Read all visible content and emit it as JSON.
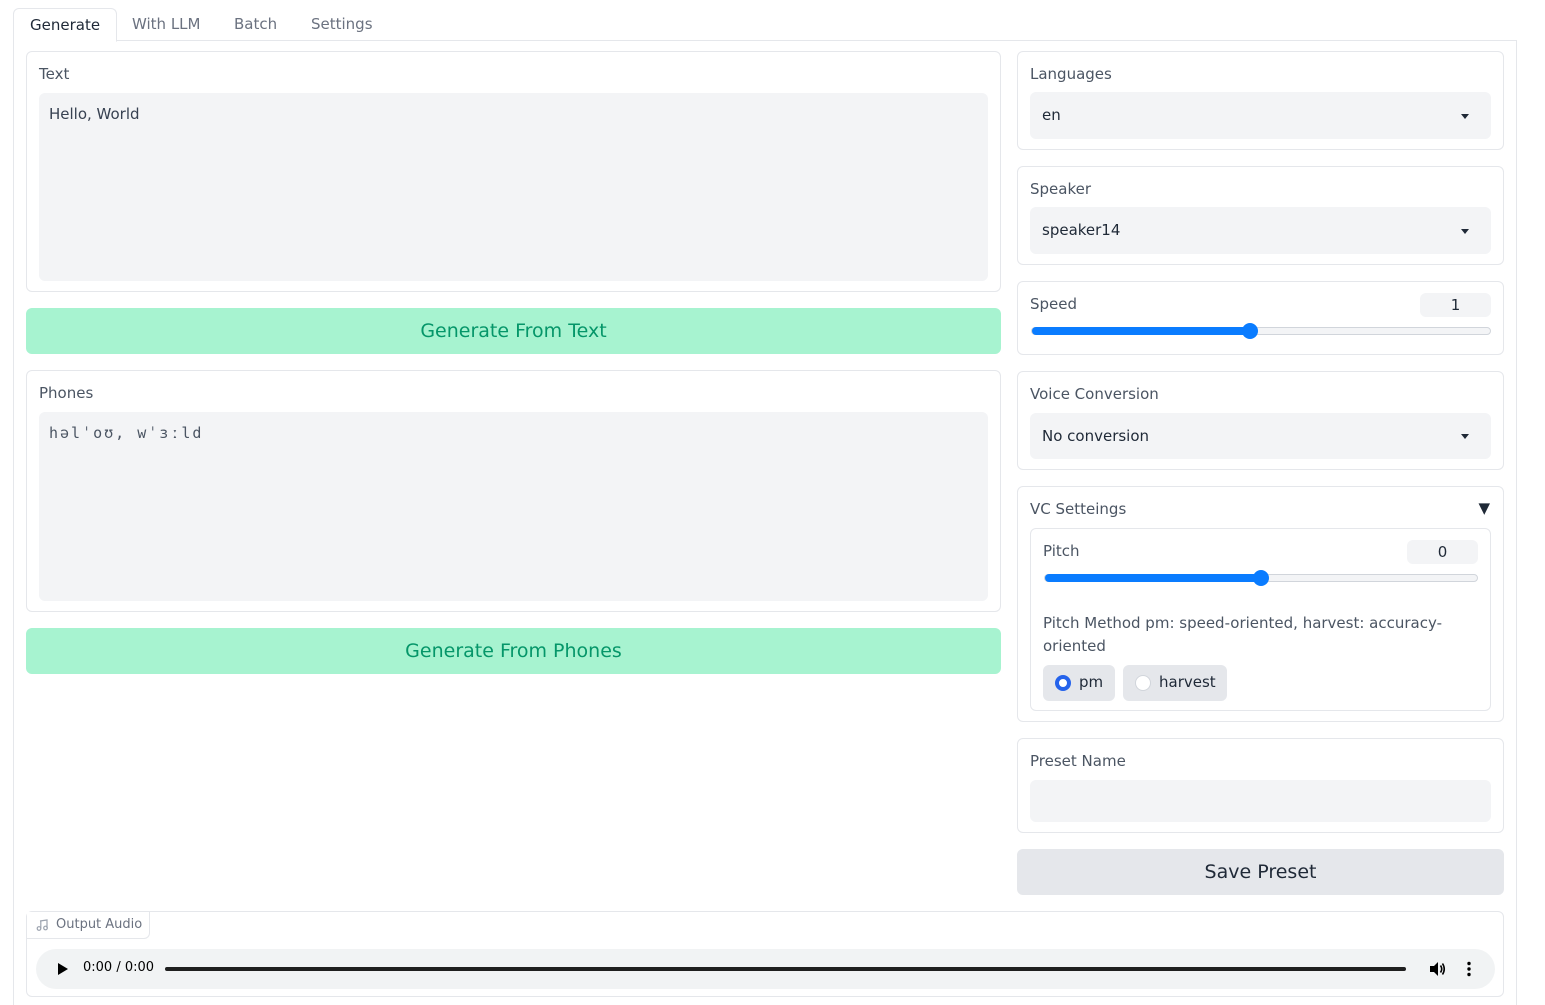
{
  "tabs": [
    "Generate",
    "With LLM",
    "Batch",
    "Settings"
  ],
  "text_panel": {
    "label": "Text",
    "value": "Hello, World"
  },
  "generate_text_button": "Generate From Text",
  "phones_panel": {
    "label": "Phones",
    "value": "həlˈoʊ, wˈɜːld"
  },
  "generate_phones_button": "Generate From Phones",
  "languages": {
    "label": "Languages",
    "value": "en"
  },
  "speaker": {
    "label": "Speaker",
    "value": "speaker14"
  },
  "speed": {
    "label": "Speed",
    "value": "1",
    "fraction": 0.475
  },
  "voice_conversion": {
    "label": "Voice Conversion",
    "value": "No conversion"
  },
  "vc_settings": {
    "label": "VC Setteings",
    "toggle": "▼",
    "pitch": {
      "label": "Pitch",
      "value": "0",
      "fraction": 0.5
    },
    "pitch_method": {
      "label": "Pitch Method pm: speed-oriented, harvest: accuracy-oriented",
      "options": [
        "pm",
        "harvest"
      ],
      "selected": "pm"
    }
  },
  "preset": {
    "label": "Preset Name",
    "value": "",
    "save_button": "Save Preset"
  },
  "output_audio": {
    "label": "Output Audio",
    "time": "0:00 / 0:00"
  },
  "colors": {
    "accent": "#0a7cff",
    "green_bg": "#a7f3d0",
    "green_text": "#059669"
  }
}
